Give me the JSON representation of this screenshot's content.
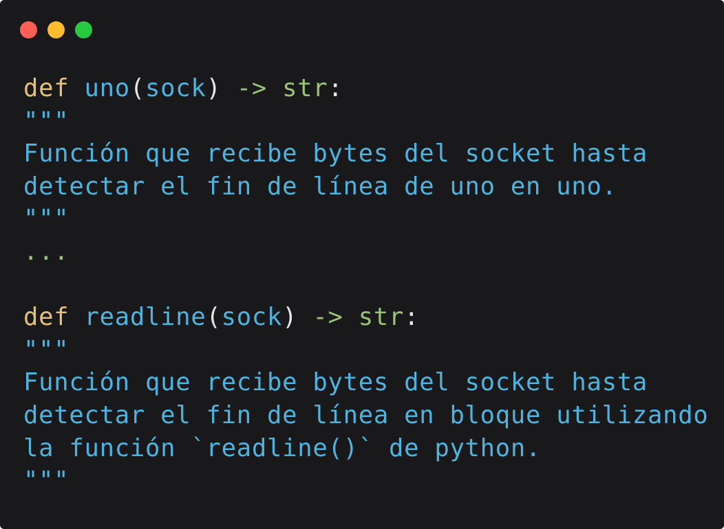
{
  "window": {
    "controls": [
      "close",
      "minimize",
      "maximize"
    ],
    "colors": {
      "background": "#19191b",
      "close": "#ff5f57",
      "minimize": "#febc2e",
      "maximize": "#28c840",
      "keyword": "#e5c07b",
      "identifier": "#4fb3e0",
      "type": "#98c379",
      "text": "#e6e6e6"
    }
  },
  "code": {
    "block1": {
      "keyword": "def",
      "name": "uno",
      "open_paren": "(",
      "param": "sock",
      "close_paren": ")",
      "arrow": "->",
      "return_type": "str",
      "colon": ":",
      "doc_open": "\"\"\"",
      "doc_lines": [
        "Función que recibe bytes del socket hasta",
        "detectar el fin de línea de uno en uno."
      ],
      "doc_close": "\"\"\"",
      "body": "..."
    },
    "block2": {
      "keyword": "def",
      "name": "readline",
      "open_paren": "(",
      "param": "sock",
      "close_paren": ")",
      "arrow": "->",
      "return_type": "str",
      "colon": ":",
      "doc_open": "\"\"\"",
      "doc_lines": [
        "Función que recibe bytes del socket hasta",
        "detectar el fin de línea en bloque utilizando",
        "la función `readline()` de python."
      ],
      "doc_close": "\"\"\""
    }
  }
}
